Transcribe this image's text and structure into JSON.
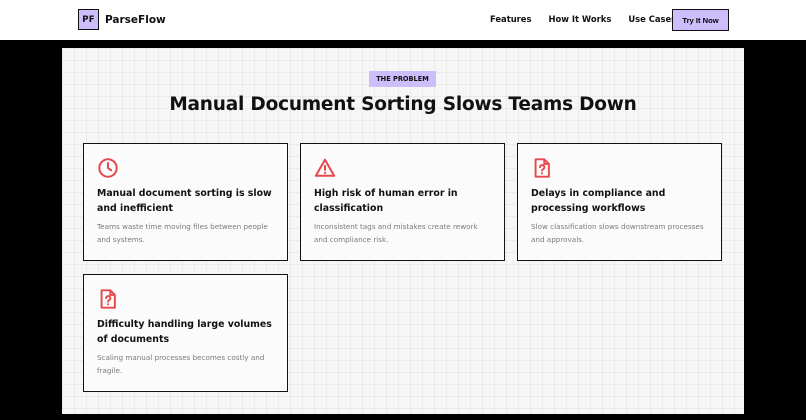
{
  "nav": {
    "logo_mark": "PF",
    "brand": "ParseFlow",
    "links": [
      "Features",
      "How It Works",
      "Use Cases"
    ],
    "cta": "Try It Now"
  },
  "problem": {
    "eyebrow": "THE PROBLEM",
    "title": "Manual Document Sorting Slows Teams Down",
    "accent_color": "#e5484d",
    "cards": [
      {
        "icon": "clock-icon",
        "title": "Manual document sorting is slow and inefficient",
        "desc": "Teams waste time moving files between people and systems."
      },
      {
        "icon": "warning-triangle-icon",
        "title": "High risk of human error in classification",
        "desc": "Inconsistent tags and mistakes create rework and compliance risk."
      },
      {
        "icon": "file-question-icon",
        "title": "Delays in compliance and processing workflows",
        "desc": "Slow classification slows downstream processes and approvals."
      },
      {
        "icon": "file-question-icon",
        "title": "Difficulty handling large volumes of documents",
        "desc": "Scaling manual processes becomes costly and fragile."
      }
    ]
  }
}
